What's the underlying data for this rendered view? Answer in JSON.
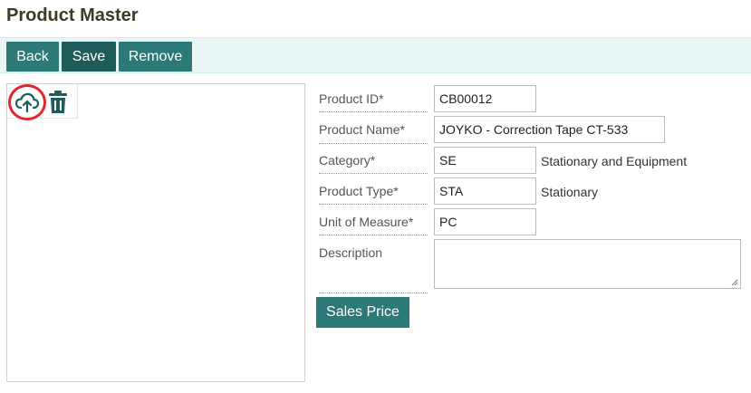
{
  "page": {
    "title": "Product Master"
  },
  "toolbar": {
    "back_label": "Back",
    "save_label": "Save",
    "remove_label": "Remove"
  },
  "image_panel": {
    "upload_icon": "cloud-upload-icon",
    "delete_icon": "trash-icon"
  },
  "form": {
    "product_id": {
      "label": "Product ID*",
      "value": "CB00012"
    },
    "product_name": {
      "label": "Product Name*",
      "value": "JOYKO - Correction Tape CT-533"
    },
    "category": {
      "label": "Category*",
      "value": "SE",
      "description": "Stationary and Equipment"
    },
    "product_type": {
      "label": "Product Type*",
      "value": "STA",
      "description": "Stationary"
    },
    "unit_of_measure": {
      "label": "Unit of Measure*",
      "value": "PC"
    },
    "description": {
      "label": "Description",
      "value": ""
    }
  },
  "actions": {
    "sales_price_label": "Sales Price"
  },
  "colors": {
    "primary": "#2b7a78",
    "primary_dark": "#1d5c5b",
    "toolbar_bg": "#eaf6f6",
    "highlight": "#e3262c"
  }
}
